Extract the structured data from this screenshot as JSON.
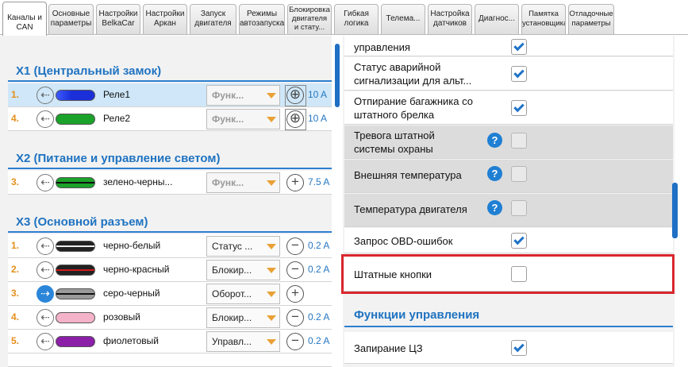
{
  "tabs": [
    {
      "label": "Каналы и\nCAN",
      "active": true
    },
    {
      "label": "Основные\nпараметры"
    },
    {
      "label": "Настройки\nBelkaCar"
    },
    {
      "label": "Настройки\nАркан"
    },
    {
      "label": "Запуск\nдвигателя"
    },
    {
      "label": "Режимы\nавтозапуска"
    },
    {
      "label": "Блокировка\nдвигателя\nи стату..."
    },
    {
      "label": "Гибкая\nлогика"
    },
    {
      "label": "Телема..."
    },
    {
      "label": "Настройка\nдатчиков"
    },
    {
      "label": "Диагнос..."
    },
    {
      "label": "Памятка\nустановщика"
    },
    {
      "label": "Отладочные\nпараметры"
    }
  ],
  "left": {
    "sections": [
      {
        "title": "X1 (Центральный замок)",
        "rows": [
          {
            "num": "1.",
            "wire": "Реле1",
            "color": "#1b2fd8",
            "dropdown": "Функ...",
            "disabled": true,
            "ctl": "⊕",
            "amp": "10 A",
            "selected": true
          },
          {
            "num": "4.",
            "wire": "Реле2",
            "color": "#1aa22a",
            "dropdown": "Функ...",
            "disabled": true,
            "ctl": "⊕",
            "amp": "10 A"
          }
        ]
      },
      {
        "title": "X2 (Питание и управление светом)",
        "rows": [
          {
            "num": "3.",
            "wire": "зелено-черны...",
            "color": "#1aa22a",
            "stripe": "#111",
            "dropdown": "Функ...",
            "disabled": true,
            "ctl": "+",
            "amp": "7.5 A"
          }
        ]
      },
      {
        "title": "X3 (Основной разъем)",
        "rows": [
          {
            "num": "1.",
            "wire": "черно-белый",
            "color": "#222",
            "stripe": "#eee",
            "dropdown": "Статус ...",
            "ctl": "−",
            "amp": "0.2 A"
          },
          {
            "num": "2.",
            "wire": "черно-красный",
            "color": "#222",
            "stripe": "#d21a1a",
            "dropdown": "Блокир...",
            "ctl": "−",
            "amp": "0.2 A"
          },
          {
            "num": "3.",
            "wire": "серо-черный",
            "color": "#9a9a9a",
            "stripe": "#111",
            "dropdown": "Оборот...",
            "ctl": "+",
            "amp": "",
            "active": true
          },
          {
            "num": "4.",
            "wire": "розовый",
            "color": "#f4b3c9",
            "dropdown": "Блокир...",
            "ctl": "−",
            "amp": "0.2 A"
          },
          {
            "num": "5.",
            "wire": "фиолетовый",
            "color": "#8b1fa8",
            "dropdown": "Управл...",
            "ctl": "−",
            "amp": "0.2 A"
          }
        ]
      }
    ]
  },
  "right": {
    "rows": [
      {
        "text": "управления",
        "checked": true,
        "partial": true
      },
      {
        "text": "Статус аварийной\nсигнализации для альт...",
        "checked": true
      },
      {
        "text": "Отпирание багажника со\nштатного брелка",
        "checked": true
      },
      {
        "text": "Тревога штатной\nсистемы охраны",
        "checked": false,
        "help": true,
        "gray": true
      },
      {
        "text": "Внешняя температура",
        "checked": false,
        "help": true,
        "gray": true
      },
      {
        "text": "Температура двигателя",
        "checked": false,
        "help": true,
        "gray": true
      },
      {
        "text": "Запрос OBD-ошибок",
        "checked": true
      },
      {
        "text": "Штатные кнопки",
        "checked": false
      },
      {
        "text": "Запирание ЦЗ",
        "checked": true
      }
    ],
    "section_title": "Функции управления"
  },
  "icons": {
    "arrow": "arrow-in-circle-icon",
    "help": "help-question-icon",
    "caret": "dropdown-caret-icon"
  }
}
